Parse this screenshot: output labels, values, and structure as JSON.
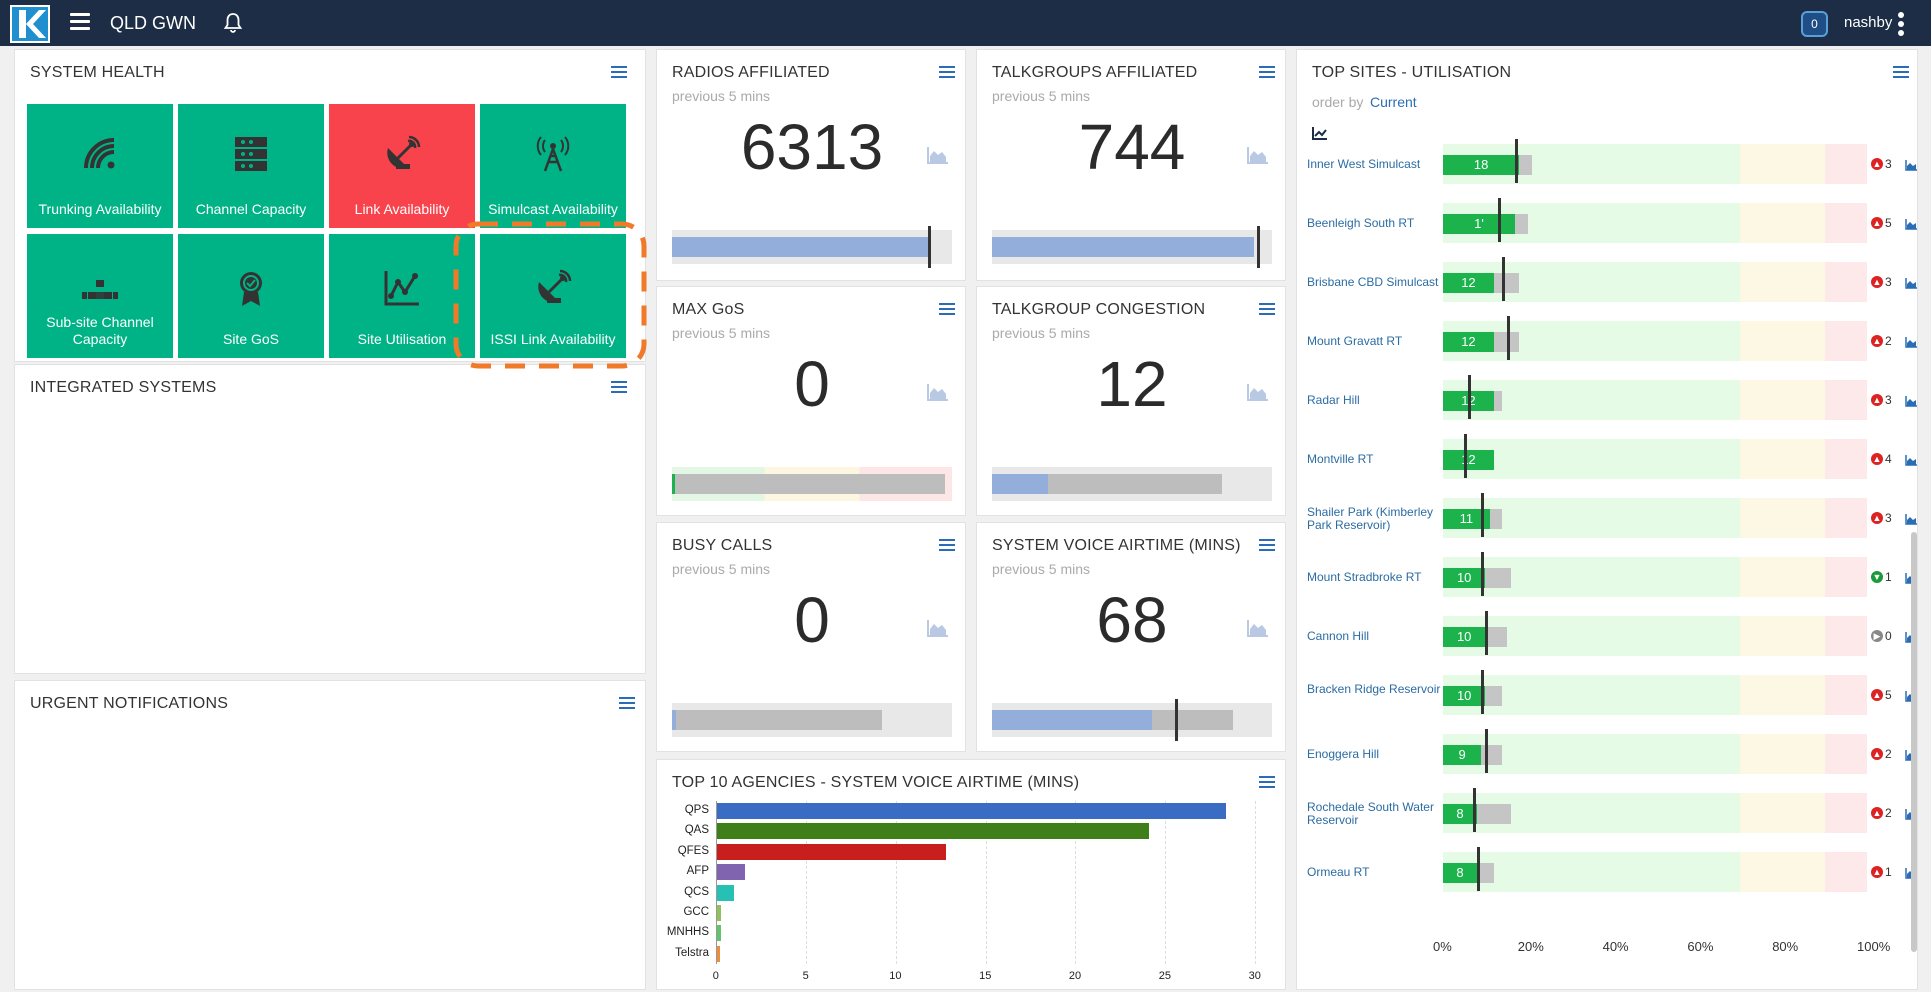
{
  "header": {
    "app_name": "QLD GWN",
    "notifications": "0",
    "user": "nashby"
  },
  "system_health": {
    "title": "SYSTEM HEALTH",
    "tiles": [
      {
        "label": "Trunking Availability",
        "status": "green",
        "icon": "wifi-icon"
      },
      {
        "label": "Channel Capacity",
        "status": "green",
        "icon": "server-rack-icon"
      },
      {
        "label": "Link Availability",
        "status": "red",
        "icon": "satellite-dish-icon"
      },
      {
        "label": "Simulcast Availability",
        "status": "green",
        "icon": "radio-tower-icon"
      },
      {
        "label": "Sub-site Channel Capacity",
        "status": "green",
        "icon": "network-blocks-icon"
      },
      {
        "label": "Site GoS",
        "status": "green",
        "icon": "award-ribbon-icon"
      },
      {
        "label": "Site Utilisation",
        "status": "green",
        "icon": "line-chart-icon"
      },
      {
        "label": "ISSI Link Availability",
        "status": "green",
        "icon": "satellite-dish-icon"
      }
    ]
  },
  "integrated_systems": {
    "title": "INTEGRATED SYSTEMS"
  },
  "urgent_notifications": {
    "title": "URGENT NOTIFICATIONS"
  },
  "kpis": [
    {
      "title": "RADIOS AFFILIATED",
      "sub": "previous 5 mins",
      "value": "6313"
    },
    {
      "title": "TALKGROUPS AFFILIATED",
      "sub": "previous 5 mins",
      "value": "744"
    },
    {
      "title": "MAX GoS",
      "sub": "previous 5 mins",
      "value": "0"
    },
    {
      "title": "TALKGROUP CONGESTION",
      "sub": "previous 5 mins",
      "value": "12"
    },
    {
      "title": "BUSY CALLS",
      "sub": "previous 5 mins",
      "value": "0"
    },
    {
      "title": "SYSTEM VOICE AIRTIME (MINS)",
      "sub": "previous 5 mins",
      "value": "68"
    }
  ],
  "chart_data": [
    {
      "type": "bar",
      "title": "TOP 10 AGENCIES - SYSTEM VOICE AIRTIME (MINS)",
      "categories": [
        "QPS",
        "QAS",
        "QFES",
        "AFP",
        "QCS",
        "GCC",
        "MNHHS",
        "Telstra"
      ],
      "values": [
        28.4,
        24.1,
        12.8,
        1.6,
        1.0,
        0.3,
        0.3,
        0.2
      ],
      "colors": [
        "#3b6cc4",
        "#3f7f1a",
        "#c81e1e",
        "#8164b0",
        "#27c0b4",
        "#92c05a",
        "#62c46a",
        "#f08c3a"
      ],
      "xticks": [
        "0",
        "5",
        "10",
        "15",
        "20",
        "25",
        "30"
      ],
      "xlim": [
        0,
        30
      ]
    },
    {
      "type": "bar",
      "title": "TOP SITES - UTILISATION",
      "order_by_label": "order by",
      "order_by_value": "Current",
      "xticks": [
        "0%",
        "20%",
        "40%",
        "60%",
        "80%",
        "100%"
      ],
      "sites": [
        {
          "name": "Inner West Simulcast",
          "value": 18,
          "label": "18",
          "max": 21,
          "mark": 17,
          "alert": "3",
          "trend": "up"
        },
        {
          "name": "Beenleigh South RT",
          "value": 17,
          "label": "1'",
          "max": 20,
          "mark": 13,
          "alert": "5",
          "trend": "up"
        },
        {
          "name": "Brisbane CBD Simulcast",
          "value": 12,
          "label": "12",
          "max": 18,
          "mark": 14,
          "alert": "3",
          "trend": "up"
        },
        {
          "name": "Mount Gravatt RT",
          "value": 12,
          "label": "12",
          "max": 18,
          "mark": 15,
          "alert": "2",
          "trend": "up"
        },
        {
          "name": "Radar Hill",
          "value": 12,
          "label": "12",
          "max": 14,
          "mark": 6,
          "alert": "3",
          "trend": "up"
        },
        {
          "name": "Montville RT",
          "value": 12,
          "label": "12",
          "max": 12,
          "mark": 5,
          "alert": "4",
          "trend": "up"
        },
        {
          "name": "Shailer Park (Kimberley Park Reservoir)",
          "value": 11,
          "label": "11",
          "max": 14,
          "mark": 9,
          "alert": "3",
          "trend": "up"
        },
        {
          "name": "Mount Stradbroke RT",
          "value": 10,
          "label": "10",
          "max": 16,
          "mark": 9,
          "alert": "1",
          "trend": "down"
        },
        {
          "name": "Cannon Hill",
          "value": 10,
          "label": "10",
          "max": 15,
          "mark": 10,
          "alert": "0",
          "trend": "flat"
        },
        {
          "name": "Bracken Ridge Reservoir",
          "value": 10,
          "label": "10",
          "max": 14,
          "mark": 9,
          "alert": "5",
          "trend": "up"
        },
        {
          "name": "Enoggera Hill",
          "value": 9,
          "label": "9",
          "max": 14,
          "mark": 10,
          "alert": "2",
          "trend": "up"
        },
        {
          "name": "Rochedale South Water Reservoir",
          "value": 8,
          "label": "8",
          "max": 16,
          "mark": 7,
          "alert": "2",
          "trend": "up"
        },
        {
          "name": "Ormeau RT",
          "value": 8,
          "label": "8",
          "max": 12,
          "mark": 8,
          "alert": "1",
          "trend": "up"
        }
      ]
    }
  ]
}
